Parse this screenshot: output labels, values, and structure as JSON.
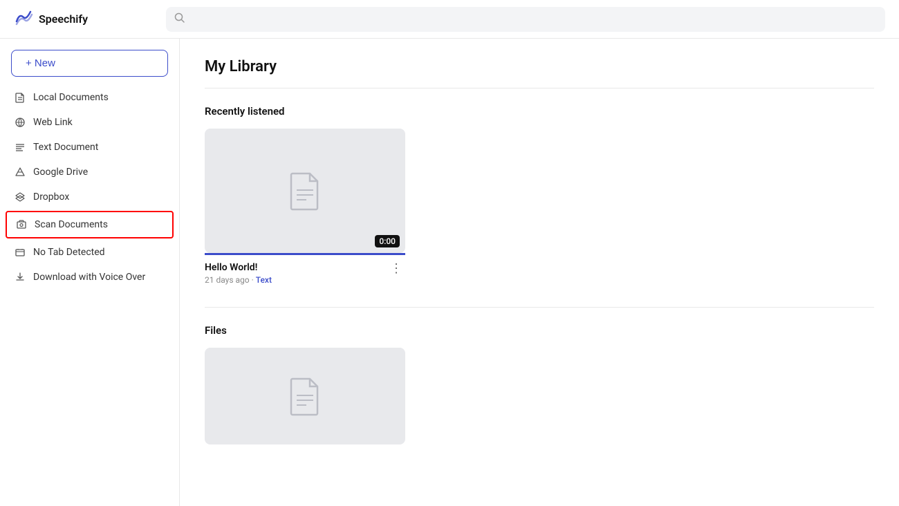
{
  "header": {
    "logo_text": "Speechify",
    "search_placeholder": ""
  },
  "sidebar": {
    "new_button_label": "+ New",
    "items": [
      {
        "id": "local-documents",
        "label": "Local Documents",
        "icon": "doc"
      },
      {
        "id": "web-link",
        "label": "Web Link",
        "icon": "cloud"
      },
      {
        "id": "text-document",
        "label": "Text Document",
        "icon": "text"
      },
      {
        "id": "google-drive",
        "label": "Google Drive",
        "icon": "drive"
      },
      {
        "id": "dropbox",
        "label": "Dropbox",
        "icon": "dropbox"
      },
      {
        "id": "scan-documents",
        "label": "Scan Documents",
        "icon": "scan",
        "highlighted": true
      },
      {
        "id": "no-tab-detected",
        "label": "No Tab Detected",
        "icon": "tab"
      },
      {
        "id": "download-voice",
        "label": "Download with Voice Over",
        "icon": "download"
      }
    ]
  },
  "main": {
    "page_title": "My Library",
    "recently_listened_title": "Recently listened",
    "files_title": "Files",
    "cards": [
      {
        "id": "hello-world",
        "title": "Hello World!",
        "meta": "21 days ago",
        "tag": "Text",
        "time": "0:00"
      }
    ]
  }
}
